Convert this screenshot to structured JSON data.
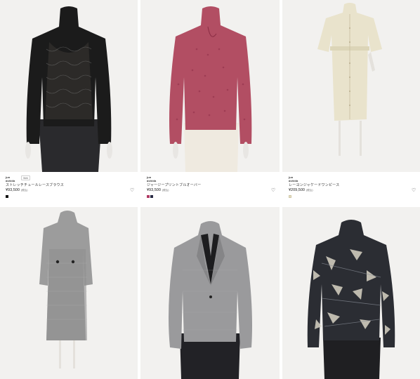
{
  "products": [
    {
      "brand": "jun ashida",
      "badge": "Web",
      "name": "ストレッチチュールレースブラウス",
      "price": "¥93,500",
      "tax": "(税込)",
      "swatches": [
        "#111111"
      ],
      "favorite_icon": "heart-outline-icon"
    },
    {
      "brand": "jun ashida",
      "badge": "",
      "name": "ジャージープリントブルオーバー",
      "price": "¥93,500",
      "tax": "(税込)",
      "swatches": [
        "#b03a63",
        "#2b2b45"
      ],
      "favorite_icon": "heart-outline-icon"
    },
    {
      "brand": "jun ashida",
      "badge": "",
      "name": "レーヨンジャケードワンピース",
      "price": "¥209,500",
      "tax": "(税込)",
      "swatches": [
        "#e7e0c4"
      ],
      "favorite_icon": "heart-outline-icon"
    },
    {
      "image": "grey-wool-dress-photo"
    },
    {
      "image": "grey-tweed-jacket-photo"
    },
    {
      "image": "black-print-blouse-photo"
    }
  ],
  "heart_glyph": "♡"
}
